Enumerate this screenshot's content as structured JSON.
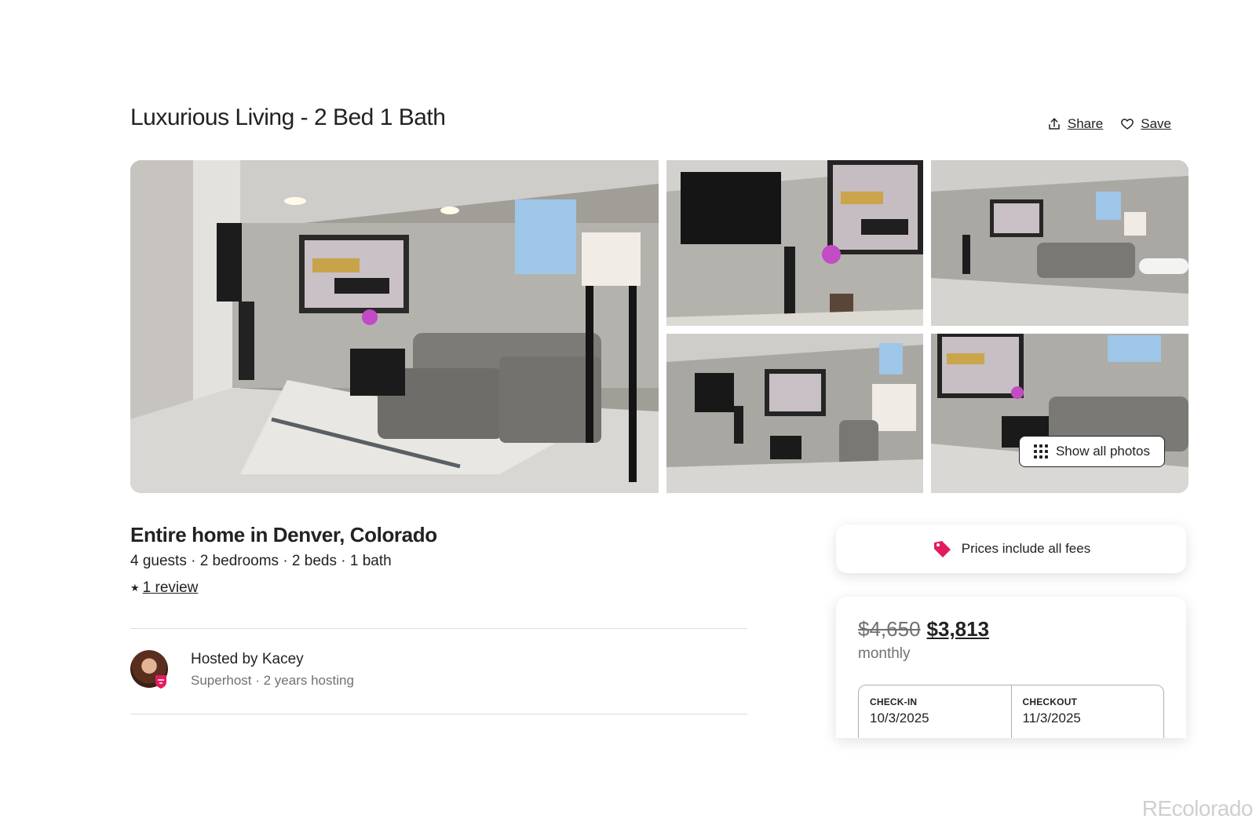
{
  "listing": {
    "title": "Luxurious Living - 2 Bed 1 Bath",
    "share_label": "Share",
    "save_label": "Save",
    "show_all_photos_label": "Show all photos",
    "type": "Entire home in Denver, Colorado",
    "details": "4 guests · 2 bedrooms · 2 beds · 1 bath",
    "review_link": "1 review"
  },
  "host": {
    "name": "Hosted by Kacey",
    "meta": "Superhost · 2 years hosting"
  },
  "booking": {
    "fees_notice": "Prices include all fees",
    "original_price": "$4,650",
    "price": "$3,813",
    "period": "monthly",
    "checkin_label": "CHECK-IN",
    "checkin_value": "10/3/2025",
    "checkout_label": "CHECKOUT",
    "checkout_value": "11/3/2025"
  },
  "watermark": "REcolorado",
  "icons": {
    "share": "share-icon",
    "save": "heart-icon",
    "show_all": "grid-dots-icon",
    "fees": "price-tag-icon",
    "review": "star-icon",
    "superhost": "superhost-badge-icon"
  },
  "colors": {
    "brand_pink": "#e31c5f",
    "text": "#222222",
    "muted": "#717171"
  }
}
